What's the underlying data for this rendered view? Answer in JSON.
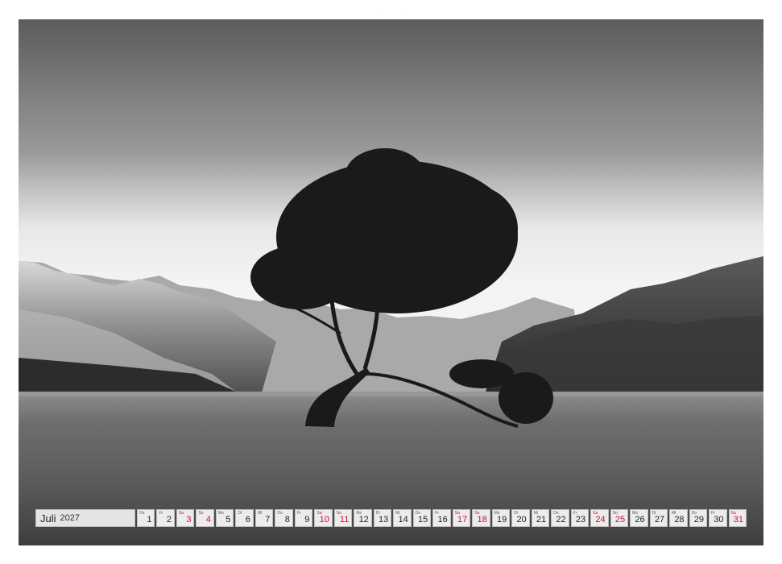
{
  "calendar": {
    "month": "Juli",
    "year": "2027",
    "days": [
      {
        "wd": "Do",
        "num": "1",
        "weekend": false
      },
      {
        "wd": "Fr",
        "num": "2",
        "weekend": false
      },
      {
        "wd": "Sa",
        "num": "3",
        "weekend": true
      },
      {
        "wd": "So",
        "num": "4",
        "weekend": true
      },
      {
        "wd": "Mo",
        "num": "5",
        "weekend": false
      },
      {
        "wd": "Di",
        "num": "6",
        "weekend": false
      },
      {
        "wd": "Mi",
        "num": "7",
        "weekend": false
      },
      {
        "wd": "Do",
        "num": "8",
        "weekend": false
      },
      {
        "wd": "Fr",
        "num": "9",
        "weekend": false
      },
      {
        "wd": "Sa",
        "num": "10",
        "weekend": true
      },
      {
        "wd": "So",
        "num": "11",
        "weekend": true
      },
      {
        "wd": "Mo",
        "num": "12",
        "weekend": false
      },
      {
        "wd": "Di",
        "num": "13",
        "weekend": false
      },
      {
        "wd": "Mi",
        "num": "14",
        "weekend": false
      },
      {
        "wd": "Do",
        "num": "15",
        "weekend": false
      },
      {
        "wd": "Fr",
        "num": "16",
        "weekend": false
      },
      {
        "wd": "Sa",
        "num": "17",
        "weekend": true
      },
      {
        "wd": "So",
        "num": "18",
        "weekend": true
      },
      {
        "wd": "Mo",
        "num": "19",
        "weekend": false
      },
      {
        "wd": "Di",
        "num": "20",
        "weekend": false
      },
      {
        "wd": "Mi",
        "num": "21",
        "weekend": false
      },
      {
        "wd": "Do",
        "num": "22",
        "weekend": false
      },
      {
        "wd": "Fr",
        "num": "23",
        "weekend": false
      },
      {
        "wd": "Sa",
        "num": "24",
        "weekend": true
      },
      {
        "wd": "So",
        "num": "25",
        "weekend": true
      },
      {
        "wd": "Mo",
        "num": "26",
        "weekend": false
      },
      {
        "wd": "Di",
        "num": "27",
        "weekend": false
      },
      {
        "wd": "Mi",
        "num": "28",
        "weekend": false
      },
      {
        "wd": "Do",
        "num": "29",
        "weekend": false
      },
      {
        "wd": "Fr",
        "num": "30",
        "weekend": false
      },
      {
        "wd": "Sa",
        "num": "31",
        "weekend": true
      }
    ]
  },
  "colors": {
    "weekend": "#c8102e",
    "sky_top": "#5a5a5a",
    "sky_horizon": "#f2f2f2",
    "water": "#6a6a6a"
  }
}
